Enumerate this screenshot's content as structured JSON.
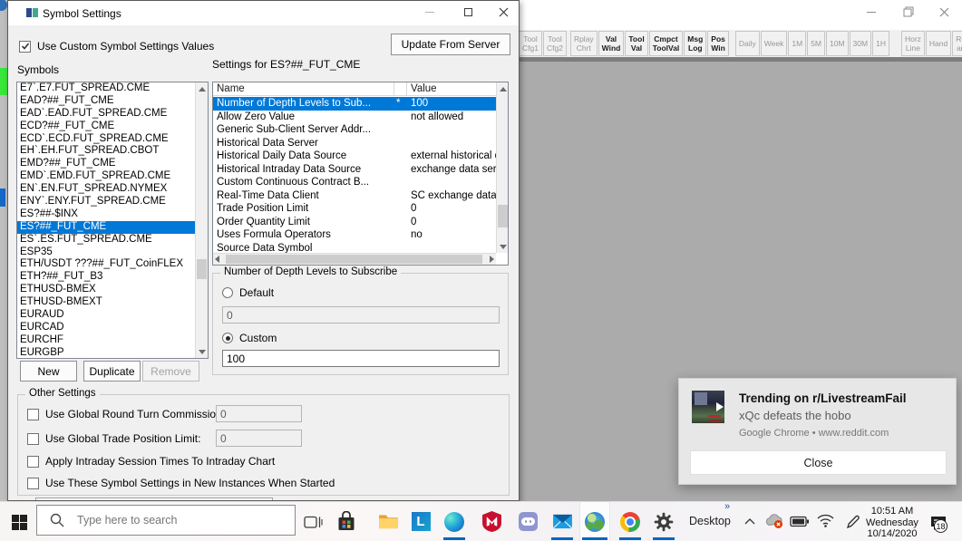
{
  "dialog": {
    "title": "Symbol Settings",
    "use_custom_checkbox_label": "Use Custom Symbol Settings Values",
    "use_custom_checked": true,
    "update_button_label": "Update From Server",
    "symbols_label": "Symbols",
    "settings_for_label": "Settings for ES?##_FUT_CME",
    "symbols": [
      "E7`.E7.FUT_SPREAD.CME",
      "EAD?##_FUT_CME",
      "EAD`.EAD.FUT_SPREAD.CME",
      "ECD?##_FUT_CME",
      "ECD`.ECD.FUT_SPREAD.CME",
      "EH`.EH.FUT_SPREAD.CBOT",
      "EMD?##_FUT_CME",
      "EMD`.EMD.FUT_SPREAD.CME",
      "EN`.EN.FUT_SPREAD.NYMEX",
      "ENY`.ENY.FUT_SPREAD.CME",
      "ES?##-$INX",
      "ES?##_FUT_CME",
      "ES`.ES.FUT_SPREAD.CME",
      "ESP35",
      "ETH/USDT ???##_FUT_CoinFLEX",
      "ETH?##_FUT_B3",
      "ETHUSD-BMEX",
      "ETHUSD-BMEXT",
      "EURAUD",
      "EURCAD",
      "EURCHF",
      "EURGBP"
    ],
    "symbols_selected_index": 11,
    "list_buttons": {
      "new": "New",
      "duplicate": "Duplicate",
      "remove": "Remove"
    },
    "table": {
      "columns": {
        "name": "Name",
        "value": "Value"
      },
      "rows": [
        {
          "name": "Number of Depth Levels to Sub...",
          "star": "*",
          "value": "100",
          "selected": true
        },
        {
          "name": "Allow Zero Value",
          "star": "",
          "value": "not allowed"
        },
        {
          "name": "Generic Sub-Client Server Addr...",
          "star": "",
          "value": ""
        },
        {
          "name": "Historical Data Server",
          "star": "",
          "value": ""
        },
        {
          "name": "Historical Daily Data Source",
          "star": "",
          "value": "external historical data serv"
        },
        {
          "name": "Historical Intraday Data Source",
          "star": "",
          "value": "exchange data service"
        },
        {
          "name": "Custom Continuous Contract B...",
          "star": "",
          "value": ""
        },
        {
          "name": "Real-Time Data Client",
          "star": "",
          "value": "SC exchange data service"
        },
        {
          "name": "Trade Position Limit",
          "star": "",
          "value": "0"
        },
        {
          "name": "Order Quantity Limit",
          "star": "",
          "value": "0"
        },
        {
          "name": "Uses Formula Operators",
          "star": "",
          "value": "no"
        },
        {
          "name": "Source Data Symbol",
          "star": "",
          "value": ""
        }
      ]
    },
    "depth_group": {
      "title": "Number of Depth Levels to Subscribe",
      "default_label": "Default",
      "default_value": "0",
      "custom_label": "Custom",
      "custom_value": "100",
      "selected": "custom"
    },
    "other_settings": {
      "title": "Other Settings",
      "items": [
        {
          "label": "Use Global Round Turn Commission:",
          "value": "0",
          "checked": false
        },
        {
          "label": "Use Global Trade Position Limit:",
          "value": "0",
          "checked": false
        },
        {
          "label": "Apply Intraday Session Times To Intraday Chart",
          "checked": false
        },
        {
          "label": "Use These Symbol Settings in New Instances When Started",
          "checked": false
        }
      ]
    }
  },
  "background_app": {
    "toolbar_buttons": [
      {
        "id": "tool-cfg1",
        "lines": [
          "Tool",
          "Cfg1"
        ],
        "enabled": false
      },
      {
        "id": "tool-cfg2",
        "lines": [
          "Tool",
          "Cfg2"
        ],
        "enabled": false
      },
      {
        "id": "rplay-chrt",
        "lines": [
          "Rplay",
          "Chrt"
        ],
        "enabled": false,
        "gap": 3
      },
      {
        "id": "val-wind",
        "lines": [
          "Val",
          "Wind"
        ],
        "enabled": true
      },
      {
        "id": "tool-val",
        "lines": [
          "Tool",
          "Val"
        ],
        "enabled": true
      },
      {
        "id": "cmpct-toolval",
        "lines": [
          "Cmpct",
          "ToolVal"
        ],
        "enabled": true
      },
      {
        "id": "msg-log",
        "lines": [
          "Msg",
          "Log"
        ],
        "enabled": true
      },
      {
        "id": "pos-win",
        "lines": [
          "Pos",
          "Win"
        ],
        "enabled": true
      },
      {
        "id": "daily",
        "lines": [
          "Daily"
        ],
        "enabled": false,
        "gap": 6
      },
      {
        "id": "week",
        "lines": [
          "Week"
        ],
        "enabled": false
      },
      {
        "id": "1m",
        "lines": [
          "1M"
        ],
        "enabled": false
      },
      {
        "id": "5m",
        "lines": [
          "5M"
        ],
        "enabled": false
      },
      {
        "id": "10m",
        "lines": [
          "10M"
        ],
        "enabled": false
      },
      {
        "id": "30m",
        "lines": [
          "30M"
        ],
        "enabled": false
      },
      {
        "id": "1h",
        "lines": [
          "1H"
        ],
        "enabled": false
      },
      {
        "id": "horz-line",
        "lines": [
          "Horz",
          "Line"
        ],
        "enabled": false,
        "gap": 12
      },
      {
        "id": "hand",
        "lines": [
          "Hand"
        ],
        "enabled": false
      },
      {
        "id": "rect-angl",
        "lines": [
          "Rect",
          "angl"
        ],
        "enabled": false
      }
    ]
  },
  "notification": {
    "title": "Trending on r/LivestreamFail",
    "subtitle": "xQc defeats the hobo",
    "source": "Google Chrome • www.reddit.com",
    "close_label": "Close"
  },
  "taskbar": {
    "search_placeholder": "Type here to search",
    "desktop_label": "Desktop",
    "overflow_chevron": "»",
    "clock": {
      "time": "10:51 AM",
      "day": "Wednesday",
      "date": "10/14/2020"
    },
    "notification_badge": "18",
    "apps": [
      {
        "name": "file-explorer",
        "running": false
      },
      {
        "name": "l-launcher",
        "running": false
      },
      {
        "name": "edge",
        "running": true
      },
      {
        "name": "mcafee",
        "running": false
      },
      {
        "name": "discord",
        "running": false
      },
      {
        "name": "mail",
        "running": true
      },
      {
        "name": "sierra-chart-globe",
        "running": true,
        "active": true
      },
      {
        "name": "chrome",
        "running": true
      },
      {
        "name": "settings-gear",
        "running": true
      }
    ]
  },
  "colors": {
    "selection_blue": "#0078d7",
    "desktop_gray": "#ababab",
    "taskbar_underline": "#0067c0",
    "notification_bg": "#e7e7e7",
    "connect_green": "#39e639"
  }
}
